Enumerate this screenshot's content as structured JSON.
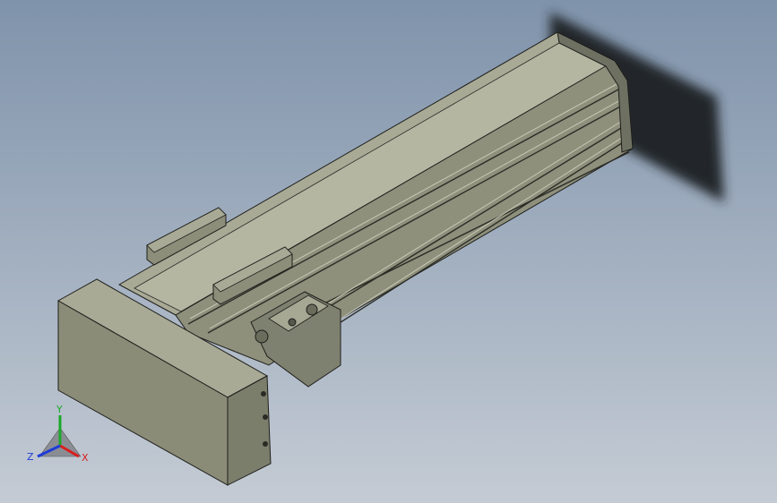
{
  "viewport": {
    "background_top": "#7f93ab",
    "background_bottom": "#c4cbd4",
    "model": {
      "name": "linear-actuator-module",
      "body_color": "#9a9c88",
      "edge_color": "#1e1e1a",
      "shadow_color": "#24272b"
    }
  },
  "triad": {
    "x_label": "X",
    "y_label": "Y",
    "z_label": "Z",
    "x_color": "#d81e1e",
    "y_color": "#1aa82a",
    "z_color": "#1e3cd8"
  }
}
